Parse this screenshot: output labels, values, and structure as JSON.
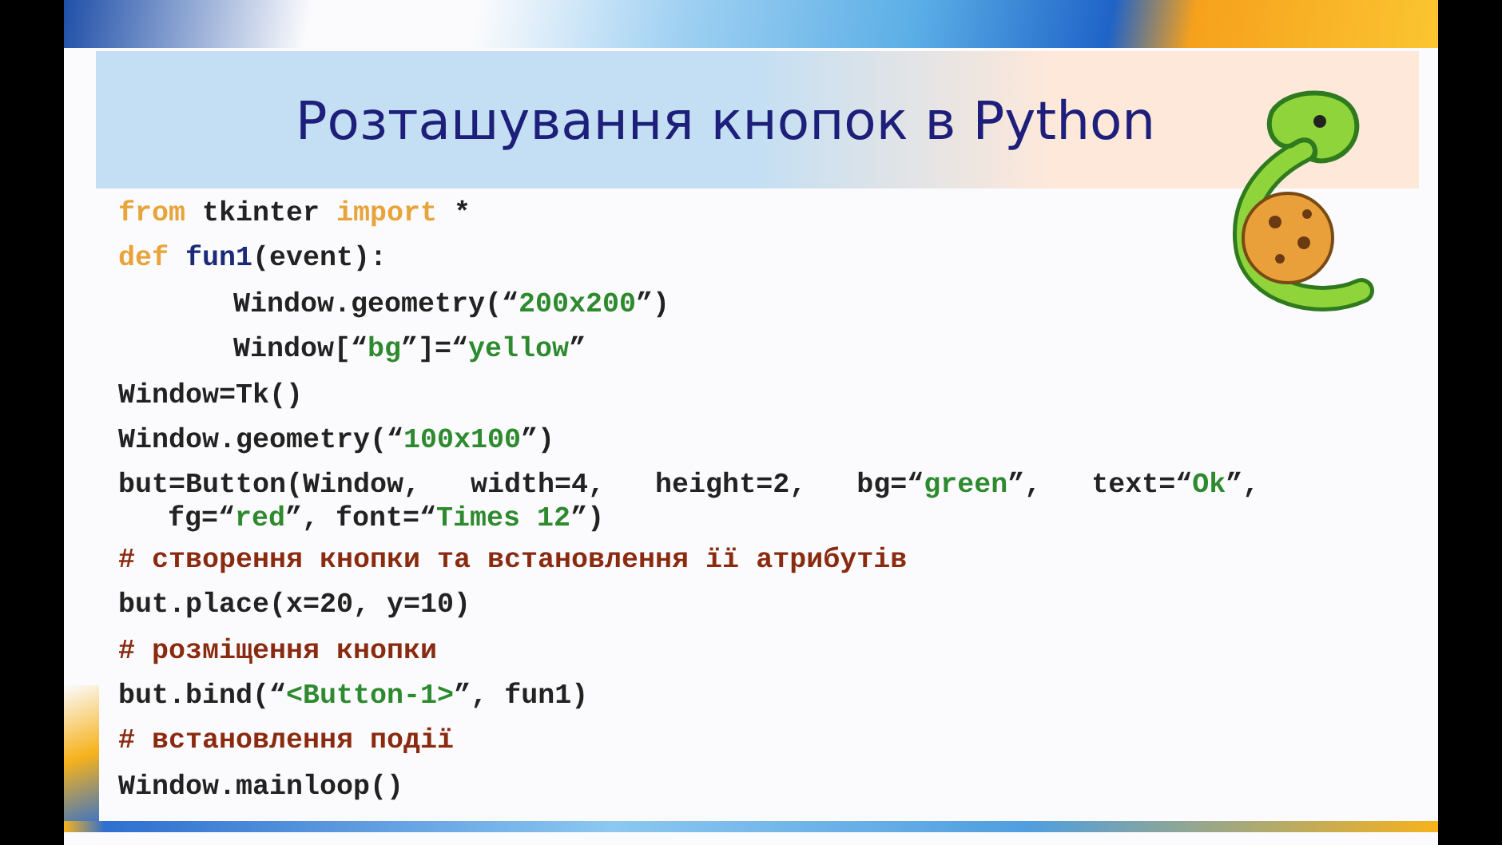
{
  "slide": {
    "title": "Розташування кнопок в Python",
    "code_lines": [
      {
        "kind": "top",
        "tokens": [
          {
            "kind": "keyword",
            "text": "from"
          },
          {
            "kind": "plain",
            "text": " tkinter "
          },
          {
            "kind": "keyword",
            "text": "import"
          },
          {
            "kind": "plain",
            "text": " *"
          }
        ]
      },
      {
        "kind": "top",
        "tokens": [
          {
            "kind": "keyword",
            "text": "def "
          },
          {
            "kind": "name",
            "text": "fun1"
          },
          {
            "kind": "plain",
            "text": "(event):"
          }
        ]
      },
      {
        "kind": "body",
        "tokens": [
          {
            "kind": "plain",
            "text": "Window.geometry(“"
          },
          {
            "kind": "string",
            "text": "200x200"
          },
          {
            "kind": "plain",
            "text": "”)"
          }
        ]
      },
      {
        "kind": "body",
        "tokens": [
          {
            "kind": "plain",
            "text": "Window[“"
          },
          {
            "kind": "string",
            "text": "bg"
          },
          {
            "kind": "plain",
            "text": "”]=“"
          },
          {
            "kind": "string",
            "text": "yellow"
          },
          {
            "kind": "plain",
            "text": "”"
          }
        ]
      },
      {
        "kind": "top",
        "tokens": [
          {
            "kind": "plain",
            "text": "Window=Tk()"
          }
        ]
      },
      {
        "kind": "top",
        "tokens": [
          {
            "kind": "plain",
            "text": "Window.geometry(“"
          },
          {
            "kind": "string",
            "text": "100x100"
          },
          {
            "kind": "plain",
            "text": "”)"
          }
        ]
      },
      {
        "kind": "top",
        "tokens": [
          {
            "kind": "plain",
            "text": "but=Button(Window,   width=4,   height=2,   bg=“"
          },
          {
            "kind": "string",
            "text": "green"
          },
          {
            "kind": "plain",
            "text": "”,   text=“"
          },
          {
            "kind": "string",
            "text": "Ok"
          },
          {
            "kind": "plain",
            "text": "”,"
          }
        ]
      },
      {
        "kind": "continuation",
        "tokens": [
          {
            "kind": "plain",
            "text": "fg=“"
          },
          {
            "kind": "string",
            "text": "red"
          },
          {
            "kind": "plain",
            "text": "”, font=“"
          },
          {
            "kind": "string",
            "text": "Times 12"
          },
          {
            "kind": "plain",
            "text": "”)"
          }
        ]
      },
      {
        "kind": "top",
        "tokens": [
          {
            "kind": "comment",
            "text": "# створення кнопки та встановлення її атрибутів"
          }
        ]
      },
      {
        "kind": "top",
        "tokens": [
          {
            "kind": "plain",
            "text": "but.place(x=20, y=10)"
          }
        ]
      },
      {
        "kind": "top",
        "tokens": [
          {
            "kind": "comment",
            "text": "# розміщення кнопки"
          }
        ]
      },
      {
        "kind": "top",
        "tokens": [
          {
            "kind": "plain",
            "text": "but.bind(“"
          },
          {
            "kind": "string",
            "text": "<Button-1>"
          },
          {
            "kind": "plain",
            "text": "”, fun1)"
          }
        ]
      },
      {
        "kind": "top",
        "tokens": [
          {
            "kind": "comment",
            "text": "# встановлення події"
          }
        ]
      },
      {
        "kind": "top",
        "tokens": [
          {
            "kind": "plain",
            "text": "Window.mainloop()"
          }
        ]
      }
    ]
  }
}
